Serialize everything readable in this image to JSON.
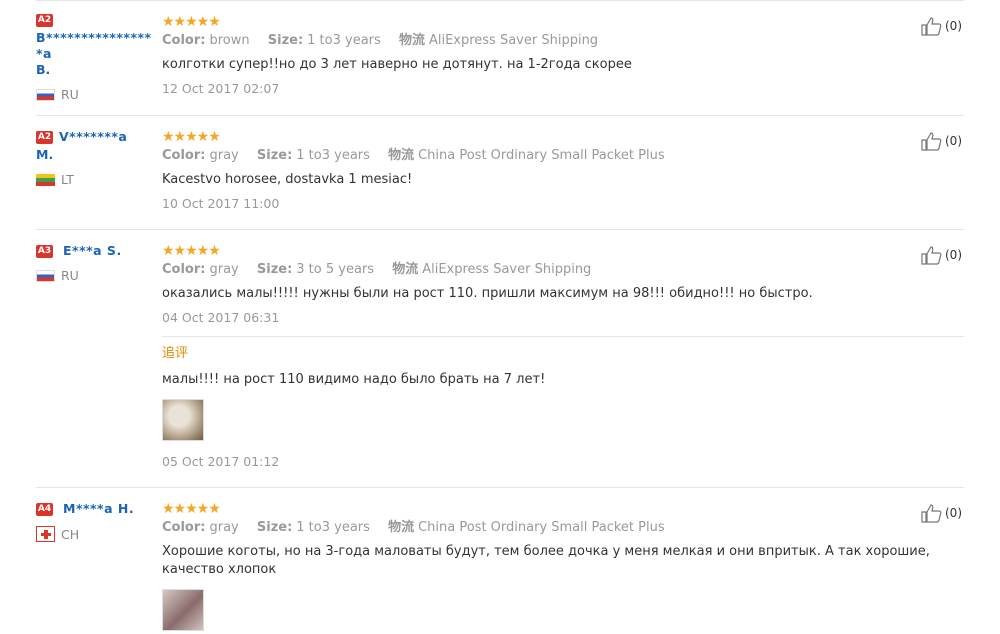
{
  "reviews": [
    {
      "level": "A2",
      "user_line1": "B****************a",
      "user_line2": "B.",
      "country": "RU",
      "stars": "★★★★★",
      "meta": {
        "color_key": "Color:",
        "color": "brown",
        "size_key": "Size:",
        "size": "1 to3 years",
        "ship_key": "物流",
        "ship": "AliExpress Saver Shipping"
      },
      "text": "колготки супер!!но до 3 лет наверно не дотянут. на 1-2года скорее",
      "date": "12 Oct 2017 02:07",
      "likes": "(0)"
    },
    {
      "level": "A2",
      "user_line1": "V*******a",
      "user_line2": "M.",
      "country": "LT",
      "stars": "★★★★★",
      "meta": {
        "color_key": "Color:",
        "color": "gray",
        "size_key": "Size:",
        "size": "1 to3 years",
        "ship_key": "物流",
        "ship": "China Post Ordinary Small Packet Plus"
      },
      "text": "Kacestvo horosee, dostavka 1 mesiac!",
      "date": "10 Oct 2017 11:00",
      "likes": "(0)"
    },
    {
      "level": "A3",
      "user_line1": "E***a S.",
      "country": "RU",
      "stars": "★★★★★",
      "meta": {
        "color_key": "Color:",
        "color": "gray",
        "size_key": "Size:",
        "size": "3 to 5 years",
        "ship_key": "物流",
        "ship": "AliExpress Saver Shipping"
      },
      "text": "оказались малы!!!!! нужны были на рост 110. пришли максимум на 98!!! обидно!!! но быстро.",
      "date": "04 Oct 2017 06:31",
      "append_title": "追评",
      "append_text": "малы!!!! на рост 110 видимо надо было брать на 7 лет!",
      "append_date": "05 Oct 2017 01:12",
      "likes": "(0)"
    },
    {
      "level": "A4",
      "user_line1": "M****a H.",
      "country": "CH",
      "stars": "★★★★★",
      "meta": {
        "color_key": "Color:",
        "color": "gray",
        "size_key": "Size:",
        "size": "1 to3 years",
        "ship_key": "物流",
        "ship": "China Post Ordinary Small Packet Plus"
      },
      "text": "Хорошие коготы, но на 3-года маловаты будут, тем более дочка у меня мелкая и они впритык. А так хорошие, качество хлопок",
      "likes": "(0)"
    }
  ]
}
